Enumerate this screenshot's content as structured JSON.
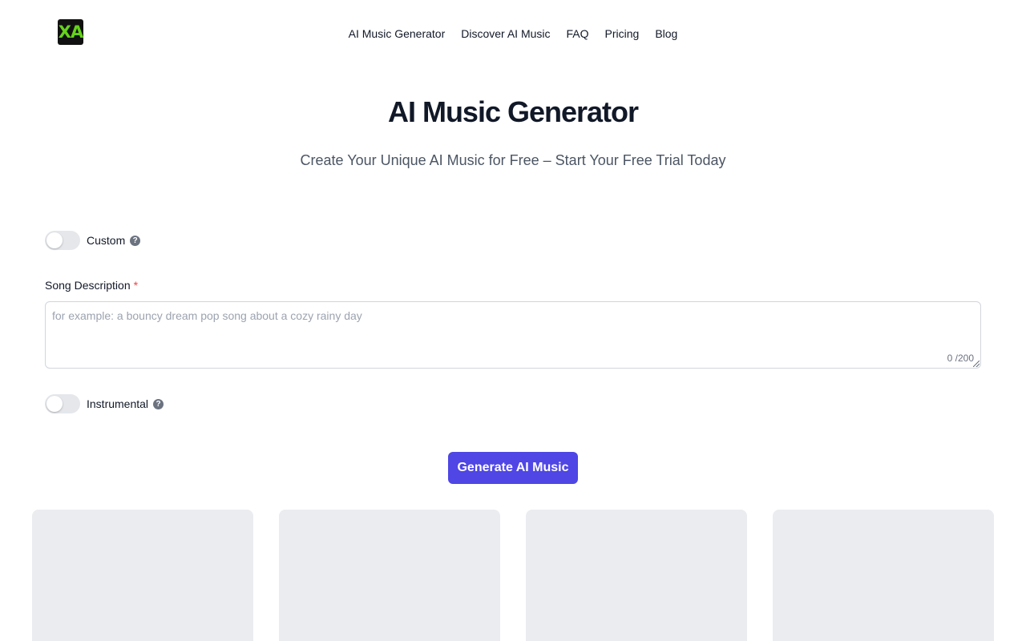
{
  "logo": {
    "text": "XA"
  },
  "nav": {
    "items": [
      "AI Music Generator",
      "Discover AI Music",
      "FAQ",
      "Pricing",
      "Blog"
    ]
  },
  "hero": {
    "title": "AI Music Generator",
    "subtitle": "Create Your Unique AI Music for Free – Start Your Free Trial Today"
  },
  "form": {
    "custom_toggle": {
      "label": "Custom",
      "on": false
    },
    "song_description": {
      "label": "Song Description",
      "required_mark": "*",
      "value": "",
      "placeholder": "for example: a bouncy dream pop song about a cozy rainy day",
      "char_count": "0 /200"
    },
    "instrumental_toggle": {
      "label": "Instrumental",
      "on": false
    },
    "help_glyph": "?",
    "help_icon": "question-circle-icon",
    "generate_label": "Generate AI Music"
  },
  "colors": {
    "primary": "#4f46e5",
    "logo_bg": "#111111",
    "logo_text": "#65d31c",
    "required": "#ef4444",
    "placeholder_card": "#ebecf0"
  }
}
